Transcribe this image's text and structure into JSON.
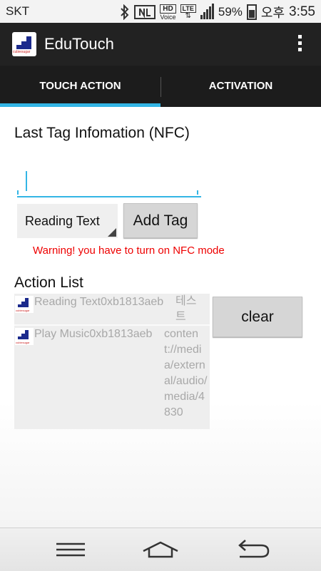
{
  "status_bar": {
    "carrier": "SKT",
    "hd_label": "HD",
    "voice_label": "Voice",
    "lte_label": "LTE",
    "battery": "59%",
    "ampm": "오후",
    "time": "3:55",
    "icons": [
      "bluetooth-icon",
      "nfc-icon",
      "hd-voice-icon",
      "lte-icon",
      "signal-icon",
      "battery-icon"
    ]
  },
  "action_bar": {
    "title": "EduTouch",
    "logo_text": "cubiesugar",
    "menu_icon": "overflow-menu-icon"
  },
  "tabs": [
    {
      "label": "TOUCH ACTION",
      "active": true
    },
    {
      "label": "ACTIVATION",
      "active": false
    }
  ],
  "content": {
    "last_tag_title": "Last Tag Infomation (NFC)",
    "tag_input_value": "",
    "spinner_value": "Reading Text",
    "add_tag_label": "Add Tag",
    "warning": "Warning! you have to  turn on NFC mode",
    "action_list_title": "Action List",
    "clear_label": "clear",
    "actions": [
      {
        "name": "Reading Text0xb1813aeb",
        "value": "테스트",
        "icon_text": "cubiesugar"
      },
      {
        "name": "Play Music0xb1813aeb",
        "value": "content://media/external/audio/media/4830",
        "icon_text": "cubiesugar"
      }
    ]
  },
  "nav_bar": {
    "icons": [
      "menu-icon",
      "home-icon",
      "back-icon"
    ]
  },
  "colors": {
    "accent": "#33b5e5",
    "warning": "#ee0000",
    "action_bar": "#222222"
  }
}
